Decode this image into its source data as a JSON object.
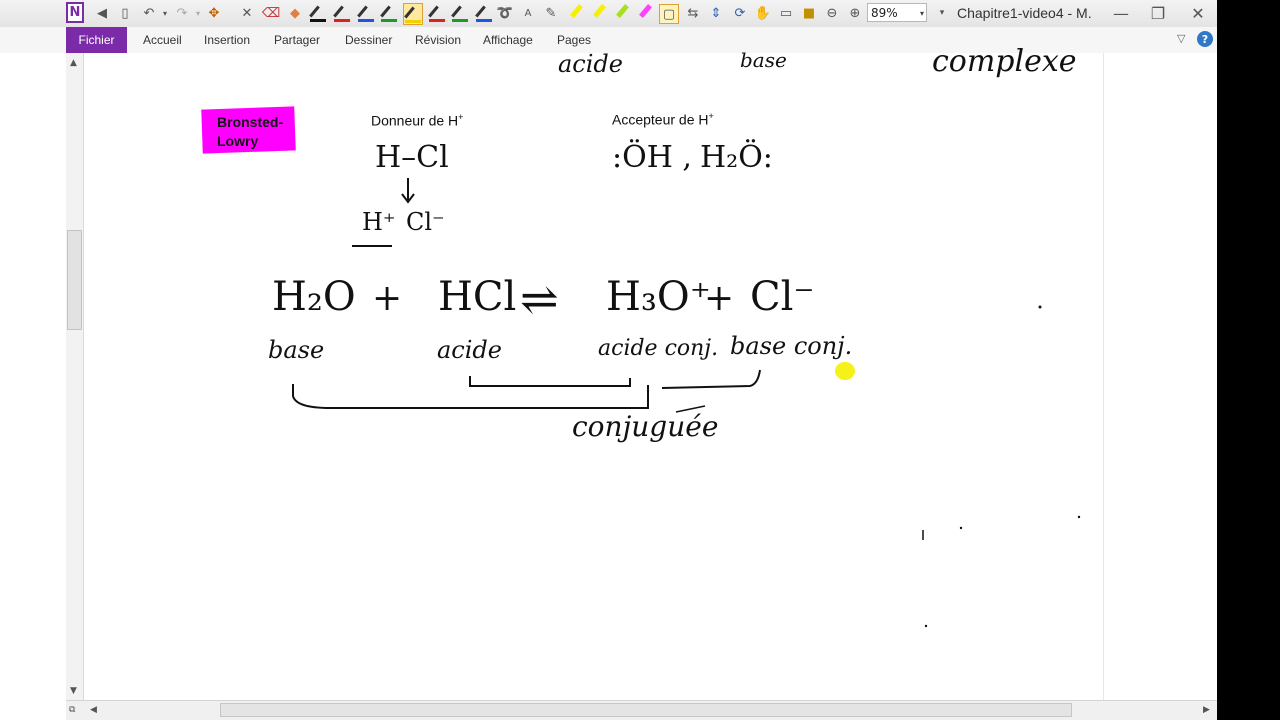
{
  "titlebar": {
    "app_icon_letter": "N",
    "zoom": "89%",
    "window_title": "Chapitre1-video4 - M."
  },
  "ribbon": {
    "tabs": [
      "Fichier",
      "Accueil",
      "Insertion",
      "Partager",
      "Dessiner",
      "Révision",
      "Affichage",
      "Pages"
    ],
    "help": "?"
  },
  "pens": [
    {
      "color": "#111111"
    },
    {
      "color": "#e02020"
    },
    {
      "color": "#2255dd"
    },
    {
      "color": "#1a9a2a"
    },
    {
      "color": "#f2d000"
    },
    {
      "color": "#e02020"
    },
    {
      "color": "#1a9a2a"
    },
    {
      "color": "#2255dd"
    }
  ],
  "highlighters": [
    {
      "color": "#f5f000"
    },
    {
      "color": "#f5f000"
    },
    {
      "color": "#a8e020"
    },
    {
      "color": "#ff40ff"
    }
  ],
  "note": {
    "badge": {
      "line1": "Bronsted-",
      "line2": "Lowry",
      "color": "#ff00ff"
    },
    "donneur": {
      "text": "Donneur de H",
      "sup": "+"
    },
    "accepteur": {
      "text": "Accepteur de H",
      "sup": "+"
    },
    "handwriting": {
      "top_acide": "acide",
      "top_base": "base",
      "top_complexe": "complexe",
      "hcl": "H–Cl",
      "hplus": "H⁺",
      "clminus": "Cl⁻",
      "oh": ":ÖH ,",
      "h2o_acc": "H₂Ö:",
      "eq_h2o": "H₂O",
      "eq_plus1": "+",
      "eq_hcl": "HCl",
      "eq_arrow": "⇌",
      "eq_h3o": "H₃O⁺",
      "eq_plus2": "+",
      "eq_cl": "Cl⁻",
      "lbl_base": "base",
      "lbl_acide": "acide",
      "lbl_acide_conj": "acide conj.",
      "lbl_base_conj": "base conj.",
      "lbl_conjuguee": "conjuguée"
    }
  }
}
